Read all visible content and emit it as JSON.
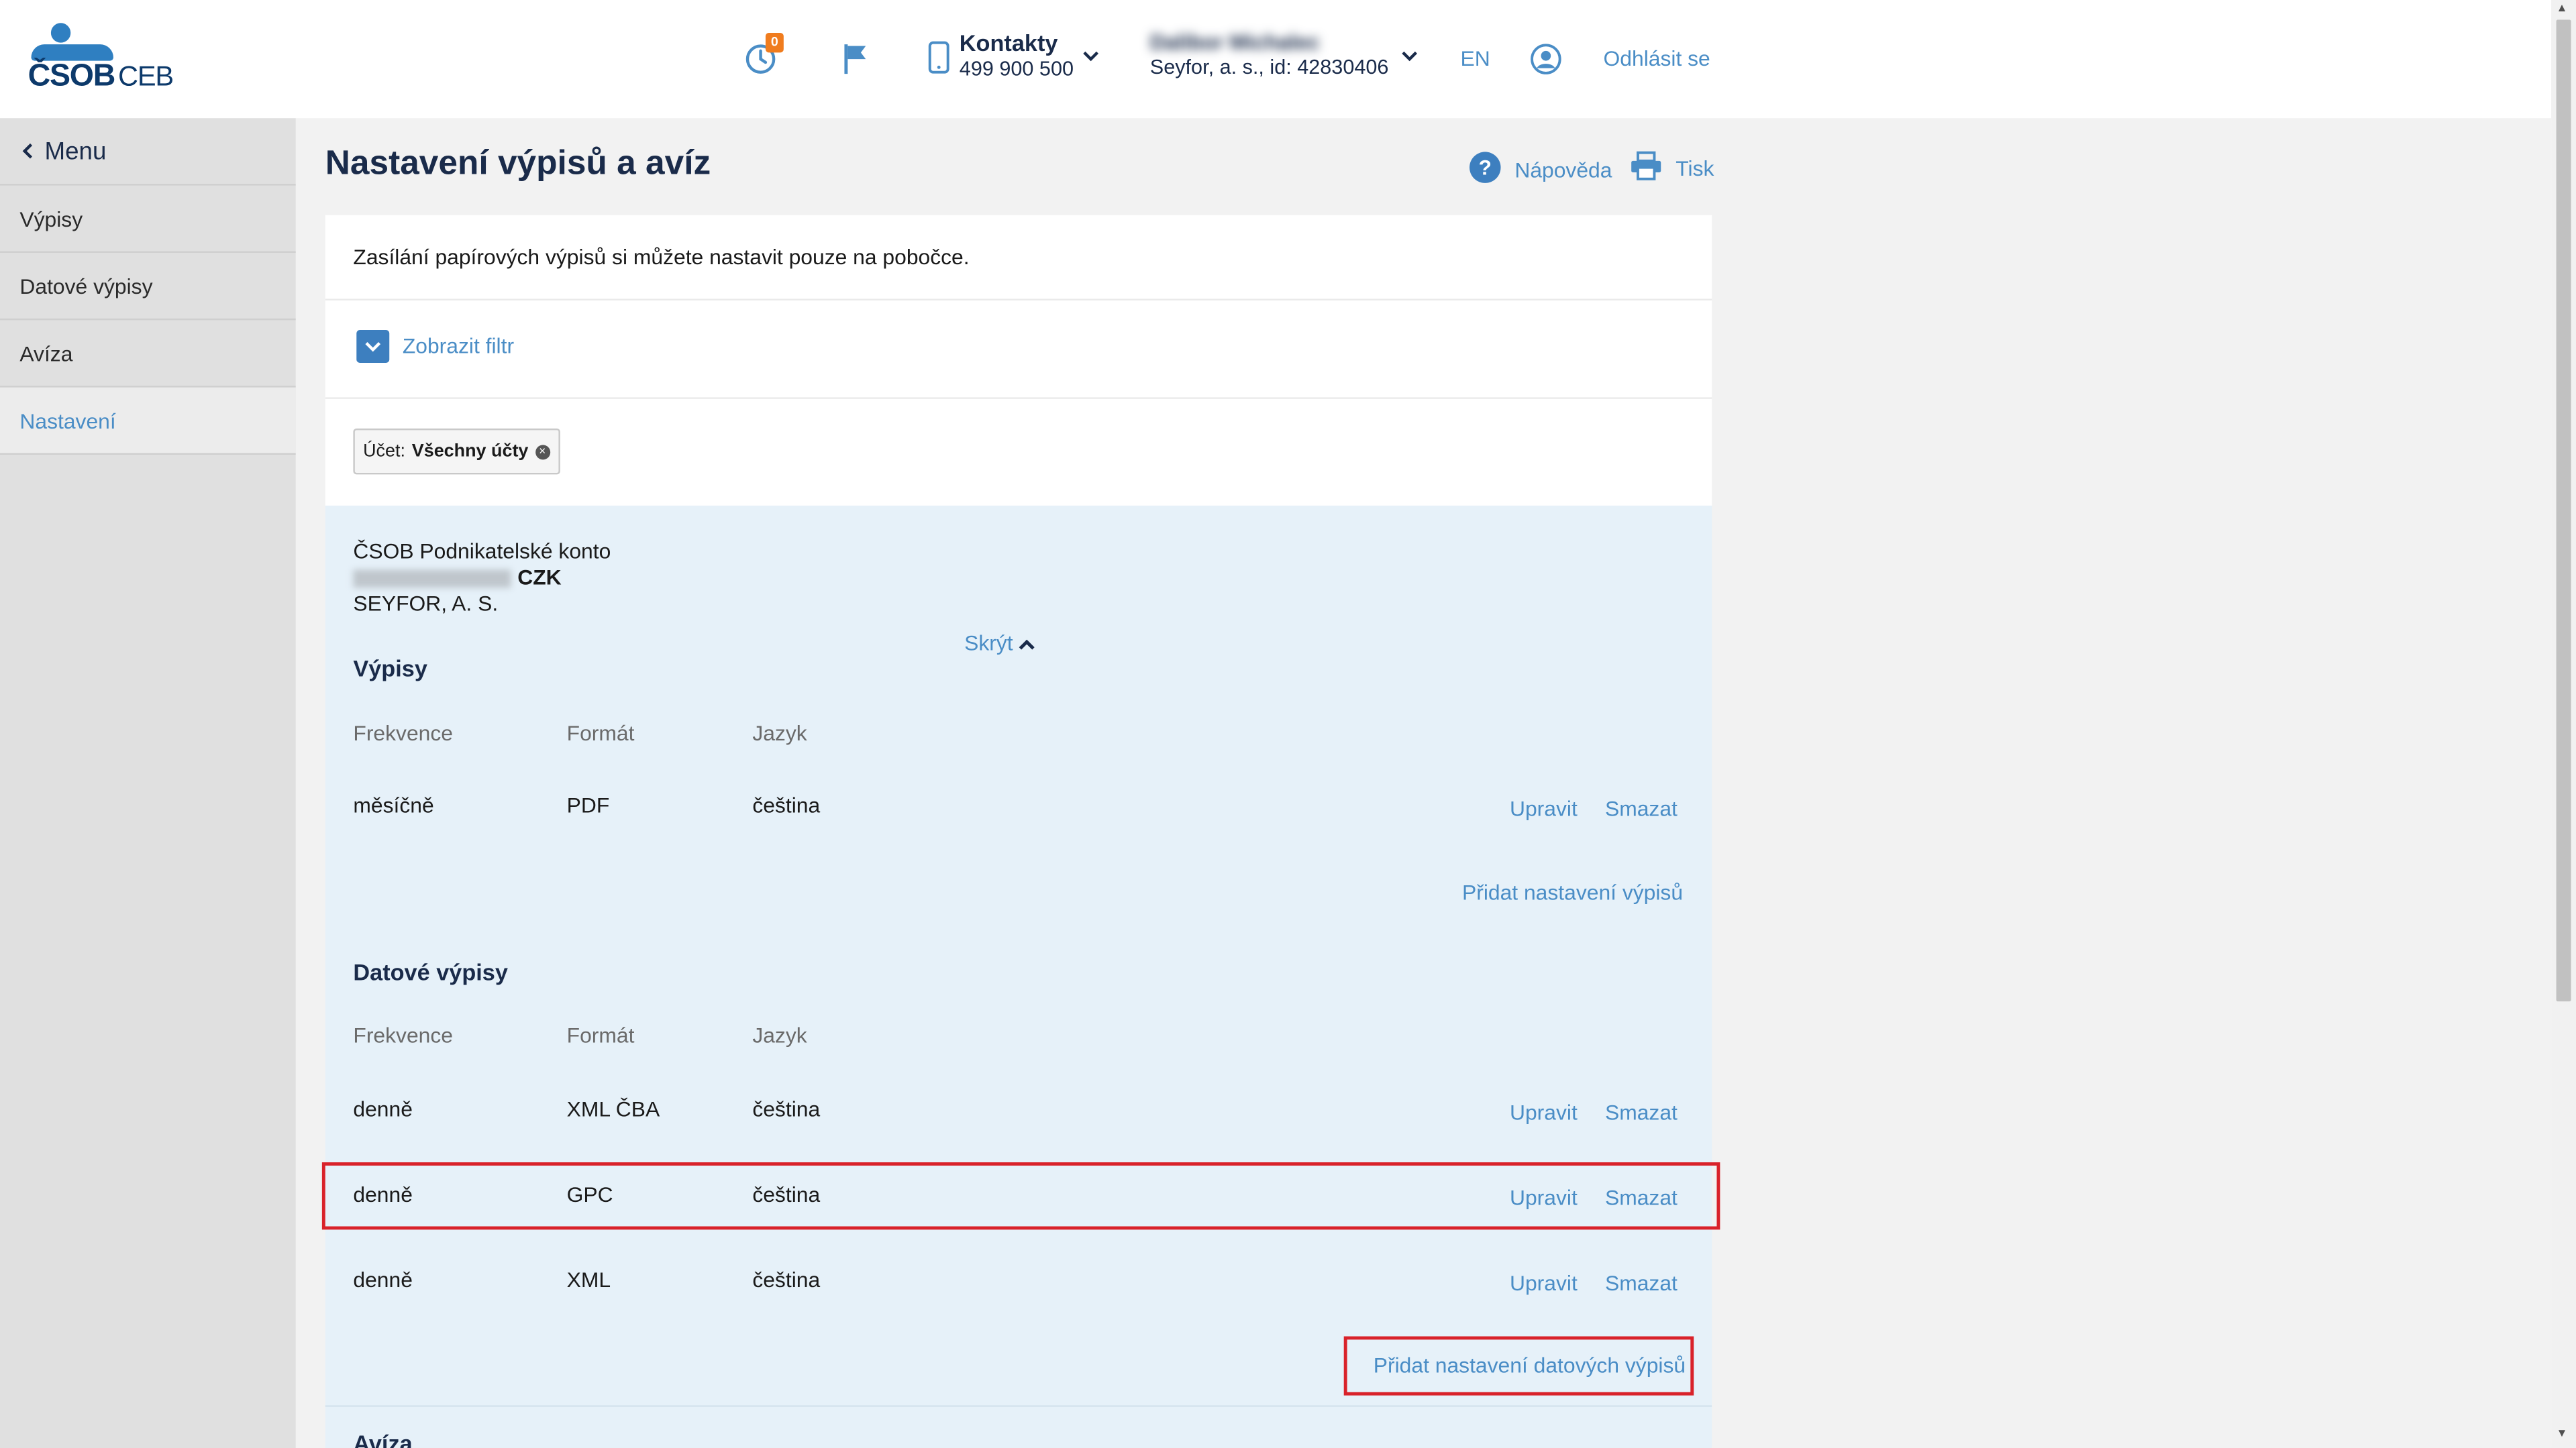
{
  "header": {
    "logo_text": "ČSOB",
    "logo_suffix": "CEB",
    "notifications_count": "0",
    "contacts_label": "Kontakty",
    "contacts_phone": "499 900 500",
    "user_name": "Dalibor Michalec",
    "user_company": "Seyfor, a. s., id: 42830406",
    "language": "EN",
    "logout": "Odhlásit se"
  },
  "sidebar": {
    "menu_label": "Menu",
    "items": [
      {
        "label": "Výpisy"
      },
      {
        "label": "Datové výpisy"
      },
      {
        "label": "Avíza"
      },
      {
        "label": "Nastavení"
      }
    ]
  },
  "page": {
    "title": "Nastavení výpisů a avíz",
    "help": "Nápověda",
    "print": "Tisk"
  },
  "panel": {
    "notice": "Zasílání papírových výpisů si můžete nastavit pouze na pobočce.",
    "filter_toggle": "Zobrazit filtr",
    "chip_label": "Účet:",
    "chip_value": "Všechny účty"
  },
  "account": {
    "name": "ČSOB Podnikatelské konto",
    "currency": "CZK",
    "holder": "SEYFOR, A. S.",
    "hide": "Skrýt"
  },
  "columns": {
    "frequency": "Frekvence",
    "format": "Formát",
    "language": "Jazyk"
  },
  "actions": {
    "edit": "Upravit",
    "delete": "Smazat"
  },
  "statements": {
    "title": "Výpisy",
    "rows": [
      {
        "frequency": "měsíčně",
        "format": "PDF",
        "language": "čeština"
      }
    ],
    "add": "Přidat nastavení výpisů"
  },
  "data_statements": {
    "title": "Datové výpisy",
    "rows": [
      {
        "frequency": "denně",
        "format": "XML ČBA",
        "language": "čeština"
      },
      {
        "frequency": "denně",
        "format": "GPC",
        "language": "čeština"
      },
      {
        "frequency": "denně",
        "format": "XML",
        "language": "čeština"
      }
    ],
    "add": "Přidat nastavení datových výpisů"
  },
  "advices": {
    "title": "Avíza"
  },
  "colors": {
    "accent": "#4a8dc6",
    "highlight": "#d9222a",
    "account_bg": "#e6f1f9"
  }
}
